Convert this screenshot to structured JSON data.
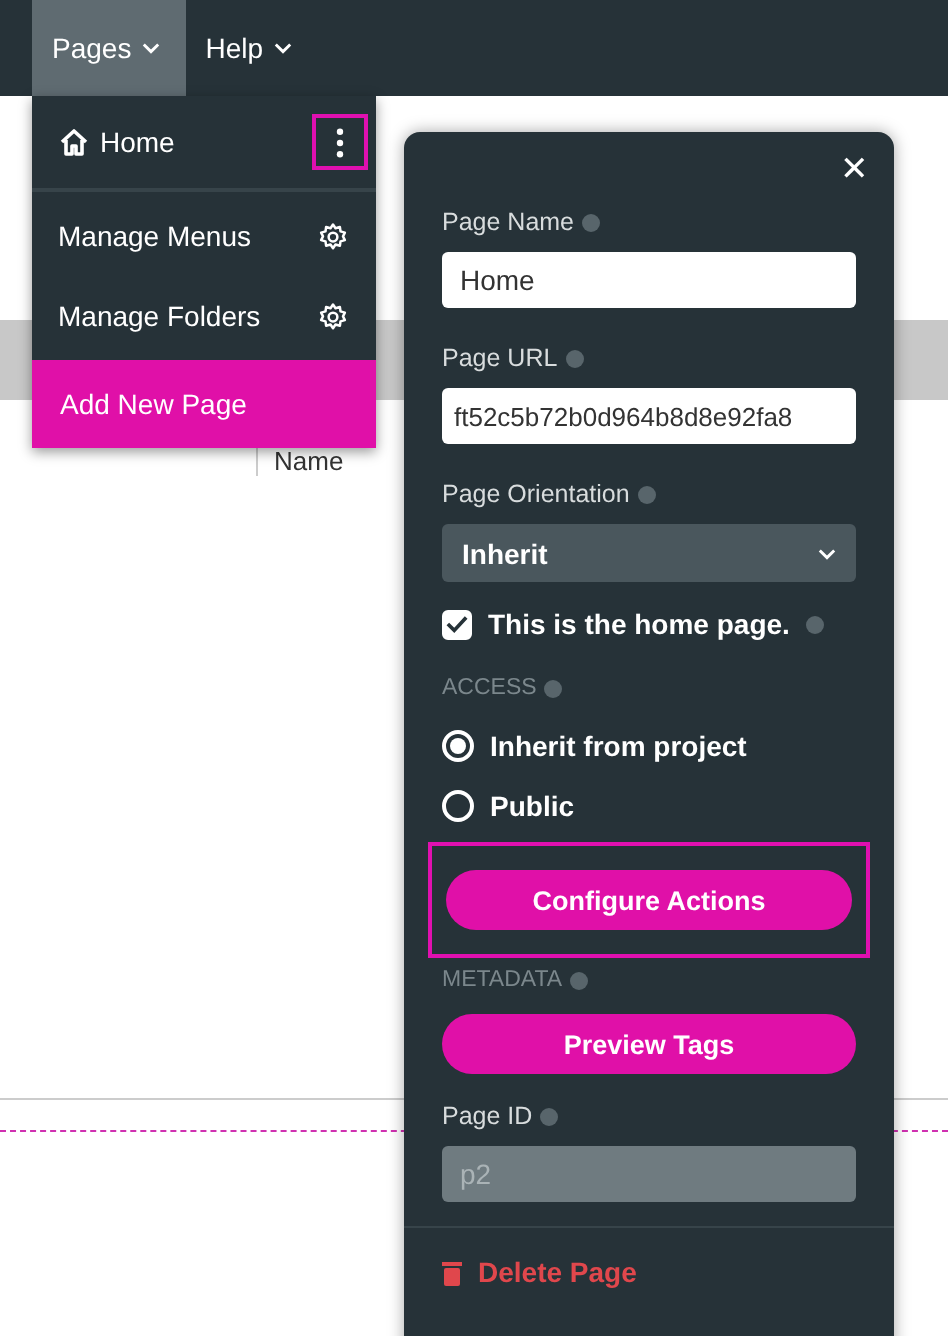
{
  "menubar": {
    "items": [
      {
        "label": "Pages",
        "selected": true
      },
      {
        "label": "Help",
        "selected": false
      }
    ]
  },
  "background_table": {
    "column_header": "Name"
  },
  "pages_menu": {
    "items": [
      {
        "kind": "page",
        "label": "Home",
        "highlighted": true
      },
      {
        "kind": "setting",
        "label": "Manage Menus"
      },
      {
        "kind": "setting",
        "label": "Manage Folders"
      },
      {
        "kind": "add",
        "label": "Add New Page"
      }
    ]
  },
  "page_panel": {
    "close_symbol": "✕",
    "page_name": {
      "label": "Page Name",
      "value": "Home"
    },
    "page_url": {
      "label": "Page URL",
      "value": "ft52c5b72b0d964b8d8e92fa8"
    },
    "page_orientation": {
      "label": "Page Orientation",
      "value": "Inherit"
    },
    "home_page": {
      "label": "This is the home page.",
      "checked": true
    },
    "access": {
      "heading": "ACCESS",
      "options": [
        {
          "label": "Inherit from project",
          "selected": true
        },
        {
          "label": "Public",
          "selected": false
        }
      ]
    },
    "configure_actions": {
      "label": "Configure Actions",
      "highlighted": true
    },
    "metadata": {
      "heading": "METADATA"
    },
    "preview_tags": {
      "label": "Preview Tags"
    },
    "page_id": {
      "label": "Page ID",
      "value": "p2"
    },
    "delete": {
      "label": "Delete Page"
    }
  }
}
